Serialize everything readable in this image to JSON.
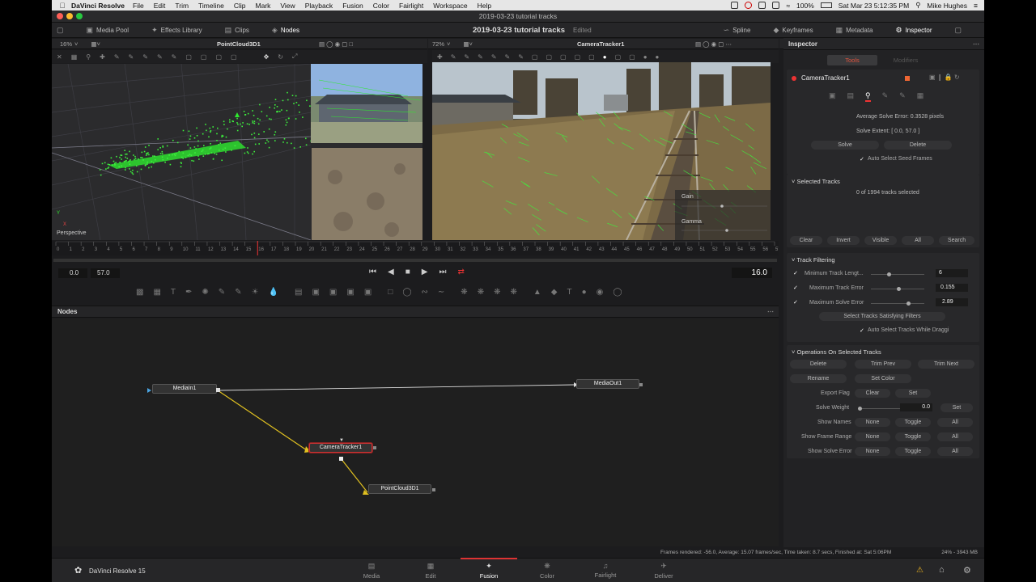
{
  "menubar": {
    "app_name": "DaVinci Resolve",
    "items": [
      "File",
      "Edit",
      "Trim",
      "Timeline",
      "Clip",
      "Mark",
      "View",
      "Playback",
      "Fusion",
      "Color",
      "Fairlight",
      "Workspace",
      "Help"
    ],
    "battery": "100%",
    "datetime": "Sat Mar 23  5:12:35 PM",
    "user": "Mike Hughes"
  },
  "window": {
    "title": "2019-03-23 tutorial tracks"
  },
  "toolbar": {
    "media_pool": "Media Pool",
    "effects_library": "Effects Library",
    "clips": "Clips",
    "nodes": "Nodes",
    "project_title": "2019-03-23 tutorial tracks",
    "edited": "Edited",
    "spline": "Spline",
    "keyframes": "Keyframes",
    "metadata": "Metadata",
    "inspector": "Inspector"
  },
  "viewer_left": {
    "zoom": "16%",
    "title": "PointCloud3D1",
    "perspective": "Perspective"
  },
  "viewer_right": {
    "zoom": "72%",
    "title": "CameraTracker1",
    "gain": "Gain",
    "gamma": "Gamma"
  },
  "timeline": {
    "ticks": [
      "0",
      "1",
      "2",
      "3",
      "4",
      "5",
      "6",
      "7",
      "8",
      "9",
      "10",
      "11",
      "12",
      "13",
      "14",
      "15",
      "16",
      "17",
      "18",
      "19",
      "20",
      "21",
      "22",
      "23",
      "24",
      "25",
      "26",
      "27",
      "28",
      "29",
      "30",
      "31",
      "32",
      "33",
      "34",
      "35",
      "36",
      "37",
      "38",
      "39",
      "40",
      "41",
      "42",
      "43",
      "44",
      "45",
      "46",
      "47",
      "48",
      "49",
      "50",
      "51",
      "52",
      "53",
      "54",
      "55",
      "56",
      "57"
    ],
    "start": "0.0",
    "end": "57.0",
    "current": "16.0"
  },
  "nodes": {
    "panel_title": "Nodes",
    "media_in": "MediaIn1",
    "media_out": "MediaOut1",
    "camera_tracker": "CameraTracker1",
    "point_cloud": "PointCloud3D1"
  },
  "status": {
    "render_info": "Frames rendered: -56.0,  Average: 15.07 frames/sec,  Time taken: 8.7 secs,  Finished at: Sat 5:06PM",
    "memory": "24% - 3943 MB"
  },
  "pages": {
    "app_label": "DaVinci Resolve 15",
    "media": "Media",
    "edit": "Edit",
    "fusion": "Fusion",
    "color": "Color",
    "fairlight": "Fairlight",
    "deliver": "Deliver"
  },
  "inspector": {
    "title": "Inspector",
    "tab_tools": "Tools",
    "tab_modifiers": "Modifiers",
    "node_name": "CameraTracker1",
    "avg_solve_error": "Average Solve Error: 0.3528 pixels",
    "solve_extent": "Solve Extent: [ 0.0, 57.0 ]",
    "solve": "Solve",
    "delete": "Delete",
    "auto_seed": "Auto Select Seed Frames",
    "selected_tracks_title": "Selected Tracks",
    "tracks_selected": "0 of 1994 tracks selected",
    "clear": "Clear",
    "invert": "Invert",
    "visible": "Visible",
    "all": "All",
    "search": "Search",
    "track_filtering_title": "Track Filtering",
    "min_track_length": "Minimum Track Lengt...",
    "min_track_length_val": "6",
    "max_track_error": "Maximum Track Error",
    "max_track_error_val": "0.155",
    "max_solve_error": "Maximum Solve Error",
    "max_solve_error_val": "2.89",
    "select_satisfying": "Select Tracks Satisfying Filters",
    "auto_select_dragging": "Auto Select Tracks While Draggi",
    "ops_title": "Operations On Selected Tracks",
    "op_delete": "Delete",
    "trim_prev": "Trim Prev",
    "trim_next": "Trim Next",
    "rename": "Rename",
    "set_color": "Set Color",
    "export_flag": "Export Flag",
    "ef_clear": "Clear",
    "ef_set": "Set",
    "solve_weight": "Solve Weight",
    "solve_weight_val": "0.0",
    "sw_set": "Set",
    "show_names": "Show Names",
    "show_frame_range": "Show Frame Range",
    "show_solve_error": "Show Solve Error",
    "none": "None",
    "toggle": "Toggle",
    "all2": "All"
  }
}
